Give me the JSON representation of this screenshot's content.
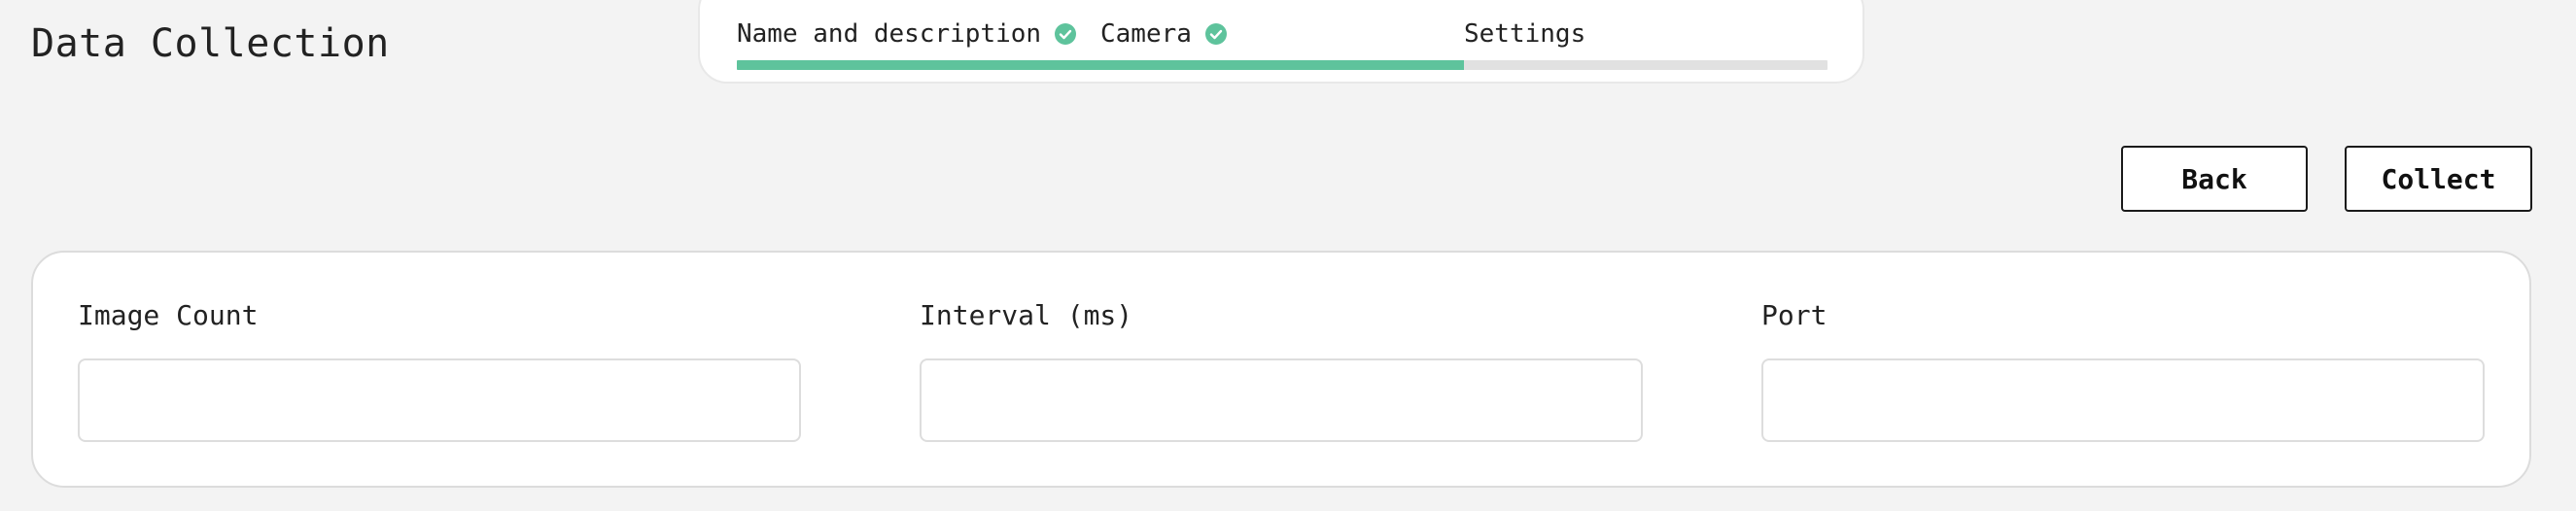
{
  "page": {
    "title": "Data Collection"
  },
  "stepper": {
    "steps": [
      {
        "label": "Name and description",
        "completed": true,
        "icon": "check-circle-icon"
      },
      {
        "label": "Camera",
        "completed": true,
        "icon": "check-circle-icon"
      },
      {
        "label": "Settings",
        "completed": false
      }
    ],
    "progress_fraction": 0.667,
    "accent_color": "#5ec39c",
    "track_color": "#e1e1e1"
  },
  "actions": {
    "back_label": "Back",
    "collect_label": "Collect"
  },
  "settings": {
    "fields": [
      {
        "label": "Image Count",
        "value": "",
        "placeholder": ""
      },
      {
        "label": "Interval (ms)",
        "value": "",
        "placeholder": ""
      },
      {
        "label": "Port",
        "value": "",
        "placeholder": ""
      }
    ]
  }
}
